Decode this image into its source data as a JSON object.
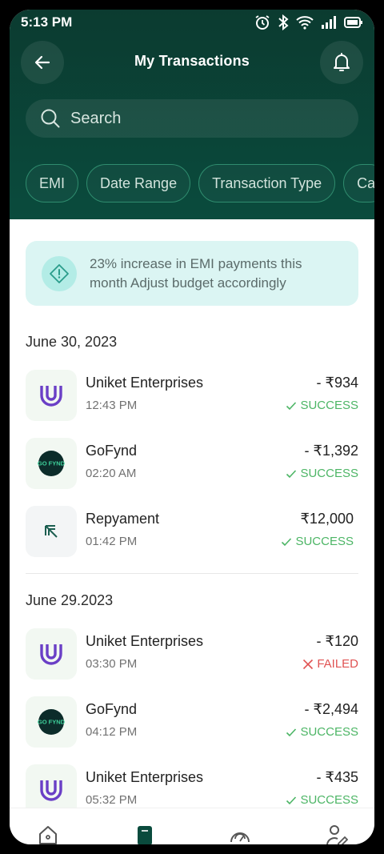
{
  "status_bar": {
    "time": "5:13 PM"
  },
  "header": {
    "title": "My Transactions"
  },
  "search": {
    "placeholder": "Search"
  },
  "filters": [
    "EMI",
    "Date Range",
    "Transaction Type",
    "Ca"
  ],
  "alert": {
    "text": "23% increase in EMI payments this month Adjust budget accordingly"
  },
  "groups": [
    {
      "date": "June 30, 2023",
      "transactions": [
        {
          "name": "Uniket Enterprises",
          "time": "12:43 PM",
          "amount": "- ₹934",
          "status": "SUCCESS",
          "logo": "uniket-logo"
        },
        {
          "name": "GoFynd",
          "time": "02:20 AM",
          "amount": "- ₹1,392",
          "status": "SUCCESS",
          "logo": "gofynd-logo"
        },
        {
          "name": "Repyament",
          "time": "01:42 PM",
          "amount": "₹12,000",
          "status": "SUCCESS",
          "logo": "repayment-arrow-icon"
        }
      ]
    },
    {
      "date": "June 29.2023",
      "transactions": [
        {
          "name": "Uniket Enterprises",
          "time": "03:30 PM",
          "amount": "- ₹120",
          "status": "FAILED",
          "logo": "uniket-logo"
        },
        {
          "name": "GoFynd",
          "time": "04:12 PM",
          "amount": "- ₹2,494",
          "status": "SUCCESS",
          "logo": "gofynd-logo"
        },
        {
          "name": "Uniket Enterprises",
          "time": "05:32 PM",
          "amount": "- ₹435",
          "status": "SUCCESS",
          "logo": "uniket-logo"
        }
      ]
    }
  ],
  "gofynd_logo_text": "GO FYND",
  "nav": [
    "home-icon",
    "transactions-icon",
    "speedometer-icon",
    "profile-edit-icon"
  ],
  "colors": {
    "header": "#0b3b30",
    "accent": "#0a4b3d",
    "success": "#4cb565",
    "failed": "#e05252",
    "alert_bg": "#dbf5f3"
  }
}
